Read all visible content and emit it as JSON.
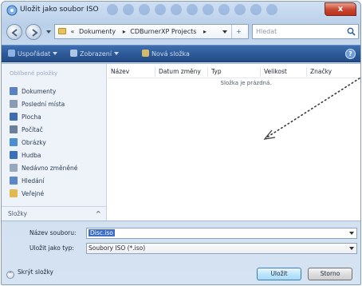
{
  "window": {
    "title": "Uložit jako soubor ISO",
    "close_label": "x"
  },
  "address": {
    "crumb_lead": "«",
    "crumbs": [
      "Dokumenty",
      "CDBurnerXP Projects"
    ],
    "separator": "▸",
    "refresh_glyph": "+",
    "search_placeholder": "Hledat"
  },
  "toolbar": {
    "organize_label": "Uspořádat",
    "views_label": "Zobrazení",
    "new_folder_label": "Nová složka",
    "help_glyph": "?"
  },
  "navpane": {
    "header": "Oblíbené položky",
    "items": [
      {
        "label": "Dokumenty",
        "icon": "documents-icon",
        "color": "#5a82c0"
      },
      {
        "label": "Poslední místa",
        "icon": "recent-places-icon",
        "color": "#8a9bb2"
      },
      {
        "label": "Plocha",
        "icon": "desktop-icon",
        "color": "#3f6db0"
      },
      {
        "label": "Počítač",
        "icon": "computer-icon",
        "color": "#6c7f98"
      },
      {
        "label": "Obrázky",
        "icon": "pictures-icon",
        "color": "#4b8fd1"
      },
      {
        "label": "Hudba",
        "icon": "music-icon",
        "color": "#3b6fb7"
      },
      {
        "label": "Nedávno změněné",
        "icon": "recently-changed-icon",
        "color": "#97a8bd"
      },
      {
        "label": "Hledání",
        "icon": "searches-icon",
        "color": "#5b87c5"
      },
      {
        "label": "Veřejné",
        "icon": "public-icon",
        "color": "#e2b94d"
      }
    ],
    "folders_label": "Složky",
    "folders_chevron": "^"
  },
  "filelist": {
    "columns": [
      "Název",
      "Datum změny",
      "Typ",
      "Velikost",
      "Značky"
    ],
    "empty_text": "Složka je prázdná."
  },
  "form": {
    "filename_label": "Název souboru:",
    "filename_value": "Disc.iso",
    "filetype_label": "Uložit jako typ:",
    "filetype_value": "Soubory ISO (*.iso)",
    "hide_folders_label": "Skrýt složky",
    "save_label": "Uložit",
    "cancel_label": "Storno"
  },
  "colors": {
    "toolbar": "#2e5a99",
    "selection": "#3a6ec9",
    "close_button": "#c8452e"
  }
}
